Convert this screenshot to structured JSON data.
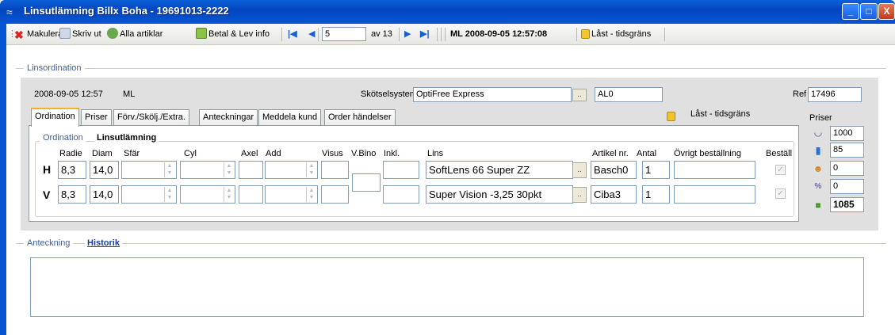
{
  "window": {
    "title": "Linsutlämning Billx Boha - 19691013-2222"
  },
  "toolbar": {
    "cancel_label": "Makulera",
    "print_label": "Skriv ut",
    "all_articles_label": "Alla artiklar",
    "pay_label": "Betal & Lev info",
    "record_value": "5",
    "record_total": "av 13",
    "stamp": "ML 2008-09-05 12:57:08",
    "lock_label": "Låst - tidsgräns"
  },
  "section": {
    "linsordination": "Linsordination",
    "anteckning": "Anteckning",
    "historik": "Historik"
  },
  "header": {
    "date": "2008-09-05 12:57",
    "user": "ML",
    "care_system_label": "Skötselsystem",
    "care_system_value": "OptiFree Express",
    "care_code": "AL0",
    "ref_label": "Ref",
    "ref_value": "17496",
    "lock_status": "Låst - tidsgräns"
  },
  "tabs": [
    "Ordination",
    "Priser",
    "Förv./Skölj./Extra.",
    "Anteckningar",
    "Meddela kund",
    "Order händelser"
  ],
  "ordination": {
    "legend": "Ordination",
    "subtitle": "Linsutlämning",
    "columns": {
      "radie": "Radie",
      "diam": "Diam",
      "sfar": "Sfär",
      "cyl": "Cyl",
      "axel": "Axel",
      "add": "Add",
      "visus": "Visus",
      "vbino": "V.Bino",
      "inkl": "Inkl.",
      "lins": "Lins",
      "artikel": "Artikel nr.",
      "antal": "Antal",
      "ovrigt": "Övrigt beställning",
      "bestall": "Beställ"
    },
    "rows": [
      {
        "eye": "H",
        "radie": "8,3",
        "diam": "14,0",
        "lens": "SoftLens 66 Super ZZ",
        "article": "Basch0",
        "qty": "1"
      },
      {
        "eye": "V",
        "radie": "8,3",
        "diam": "14,0",
        "lens": "Super Vision -3,25  30pkt",
        "article": "Ciba3",
        "qty": "1"
      }
    ]
  },
  "prices": {
    "label": "Priser",
    "lens": "1000",
    "care": "85",
    "discount": "0",
    "percent": "0",
    "total": "1085"
  }
}
